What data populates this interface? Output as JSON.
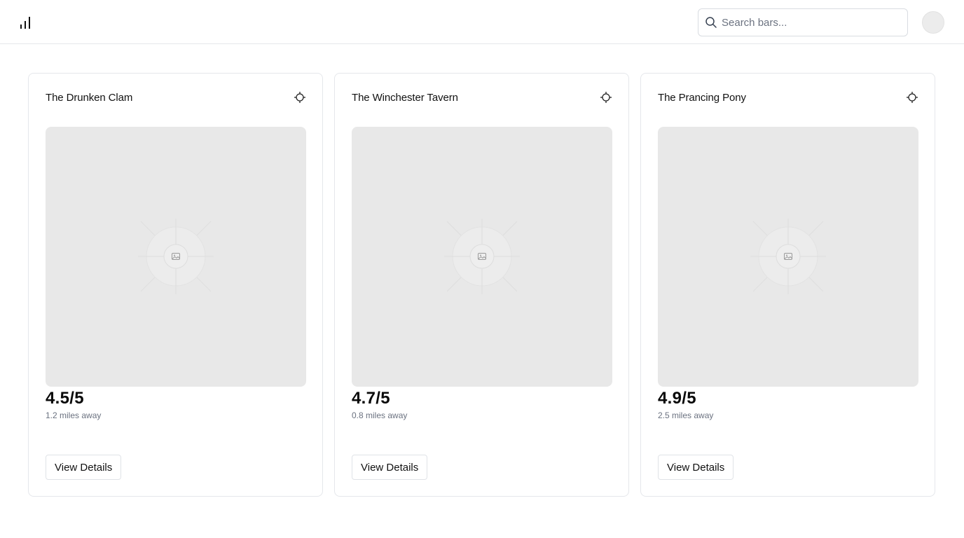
{
  "header": {
    "logo_icon": "bar-chart-icon",
    "search": {
      "placeholder": "Search bars...",
      "value": "",
      "icon": "search-icon"
    },
    "avatar_icon": "avatar"
  },
  "bars": [
    {
      "name": "The Drunken Clam",
      "rating": "4.5/5",
      "distance": "1.2 miles away",
      "button_label": "View Details",
      "locate_icon": "crosshair-icon",
      "image_icon": "image-placeholder-icon"
    },
    {
      "name": "The Winchester Tavern",
      "rating": "4.7/5",
      "distance": "0.8 miles away",
      "button_label": "View Details",
      "locate_icon": "crosshair-icon",
      "image_icon": "image-placeholder-icon"
    },
    {
      "name": "The Prancing Pony",
      "rating": "4.9/5",
      "distance": "2.5 miles away",
      "button_label": "View Details",
      "locate_icon": "crosshair-icon",
      "image_icon": "image-placeholder-icon"
    }
  ],
  "colors": {
    "border": "#e5e7eb",
    "image_bg": "#e8e8e8",
    "muted_text": "#6b7280"
  }
}
